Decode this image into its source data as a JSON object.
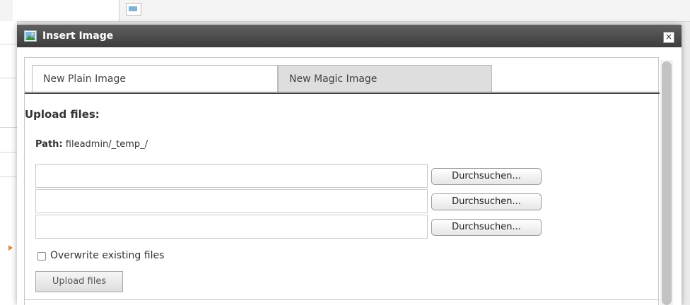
{
  "dialog": {
    "title": "Insert Image",
    "close_glyph": "×"
  },
  "tabs": [
    {
      "label": "New Plain Image",
      "active": true
    },
    {
      "label": "New Magic Image",
      "active": false
    }
  ],
  "upload": {
    "section_title": "Upload files:",
    "path_label": "Path:",
    "path_value": "fileadmin/_temp_/",
    "file_inputs": [
      {
        "value": "",
        "browse_label": "Durchsuchen..."
      },
      {
        "value": "",
        "browse_label": "Durchsuchen..."
      },
      {
        "value": "",
        "browse_label": "Durchsuchen..."
      }
    ],
    "overwrite_label": "Overwrite existing files",
    "overwrite_checked": false,
    "submit_label": "Upload files"
  },
  "icons": {
    "title": "image-icon",
    "close": "close-icon"
  },
  "colors": {
    "titlebar": "#4a4a4a",
    "tab_inactive": "#dedede"
  }
}
